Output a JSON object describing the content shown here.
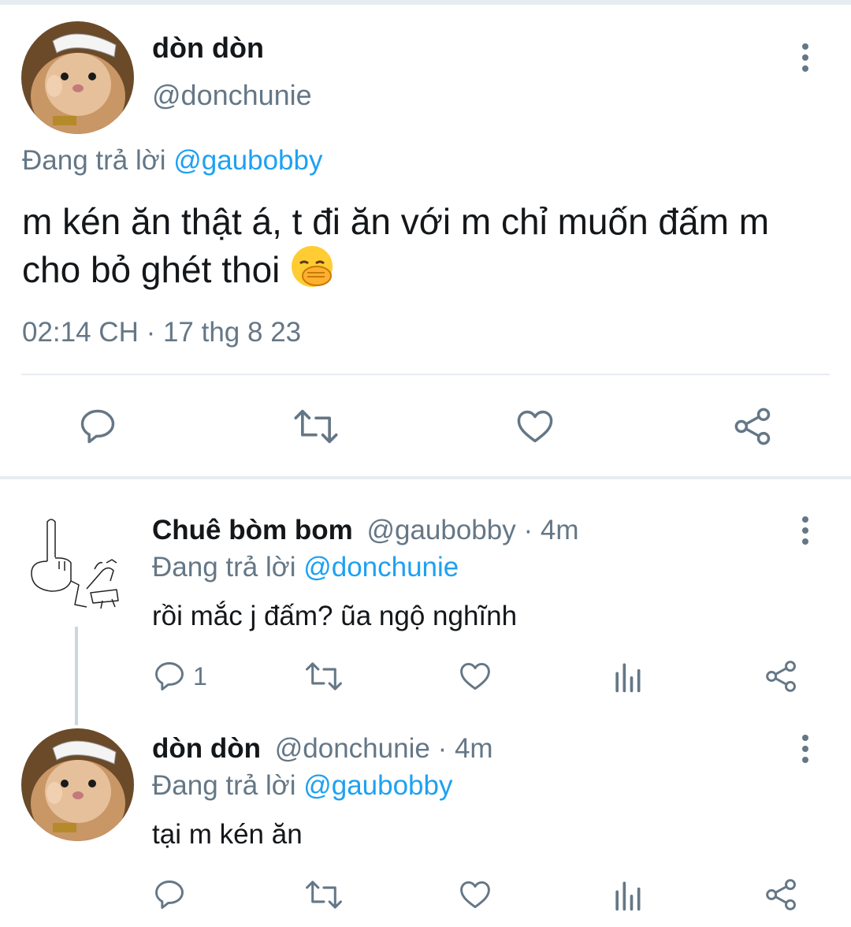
{
  "main_tweet": {
    "display_name": "dòn dòn",
    "handle": "@donchunie",
    "reply_prefix": "Đang trả lời",
    "reply_to": "@gaubobby",
    "text_line1": "m kén ăn thật á, t đi ăn với m chỉ muốn đấm m",
    "text_line2": "cho bỏ ghét thoi",
    "emoji": "face-with-hand-over-mouth",
    "timestamp": "02:14 CH · 17 thg 8 23"
  },
  "replies": [
    {
      "display_name": "Chuê bòm bom",
      "handle": "@gaubobby",
      "time": "· 4m",
      "reply_prefix": "Đang trả lời",
      "reply_to": "@donchunie",
      "text": "rồi mắc j đấm? ũa ngộ nghĩnh",
      "reply_count": "1"
    },
    {
      "display_name": "dòn dòn",
      "handle": "@donchunie",
      "time": "· 4m",
      "reply_prefix": "Đang trả lời",
      "reply_to": "@gaubobby",
      "text": "tại m kén ăn",
      "reply_count": ""
    }
  ],
  "colors": {
    "link": "#1da1f2",
    "secondary": "#657786",
    "divider": "#e6ecf0"
  },
  "icons": [
    "reply-icon",
    "retweet-icon",
    "like-icon",
    "share-icon",
    "analytics-icon",
    "more-icon"
  ]
}
